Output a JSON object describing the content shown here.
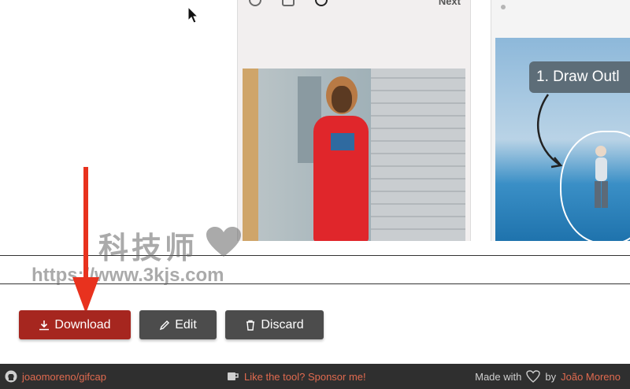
{
  "preview": {
    "left_next_label": "Next",
    "callout_text": "1. Draw Outl"
  },
  "watermark": {
    "chinese": "科技师",
    "url": "https://www.3kjs.com"
  },
  "actions": {
    "download_label": "Download",
    "edit_label": "Edit",
    "discard_label": "Discard"
  },
  "footer": {
    "repo_link": "joaomoreno/gifcap",
    "sponsor_link": "Like the tool? Sponsor me!",
    "made_with": "Made with",
    "by": "by",
    "author_link": "João Moreno"
  },
  "colors": {
    "download_bg": "#a6261f",
    "secondary_bg": "#4c4c4c",
    "footer_bg": "#2f2f2f",
    "link": "#e06a4f",
    "annotation_arrow": "#e8321e"
  }
}
